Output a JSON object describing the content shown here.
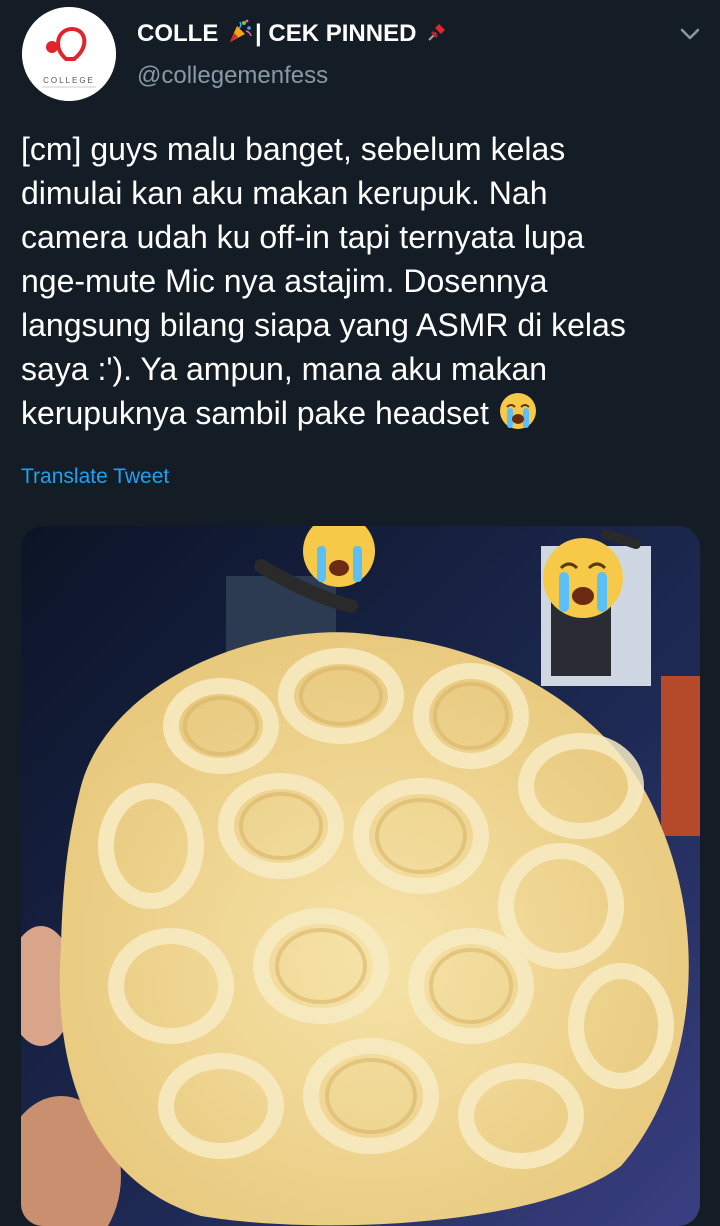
{
  "account": {
    "name_part1": "COLLE",
    "name_part2": "| CEK PINNED",
    "handle": "@collegemenfess",
    "avatar_text": "COLLEGE"
  },
  "tweet": {
    "lines": [
      "[cm] guys malu banget, sebelum kelas",
      "dimulai kan aku makan kerupuk. Nah",
      "camera udah ku off-in tapi ternyata lupa",
      "nge-mute Mic nya astajim. Dosennya",
      "langsung bilang siapa yang ASMR di kelas",
      "saya :'). Ya ampun, mana aku makan",
      "kerupuknya sambil pake headset"
    ],
    "translate_label": "Translate Tweet"
  },
  "icons": {
    "party": "party-popper-icon",
    "pin": "pushpin-icon",
    "caret": "chevron-down-icon",
    "emoji": "loudly-crying-face-icon"
  },
  "colors": {
    "background": "#141d26",
    "secondary_text": "#8899a6",
    "link": "#1da1f2",
    "brand_red": "#e0252b"
  }
}
